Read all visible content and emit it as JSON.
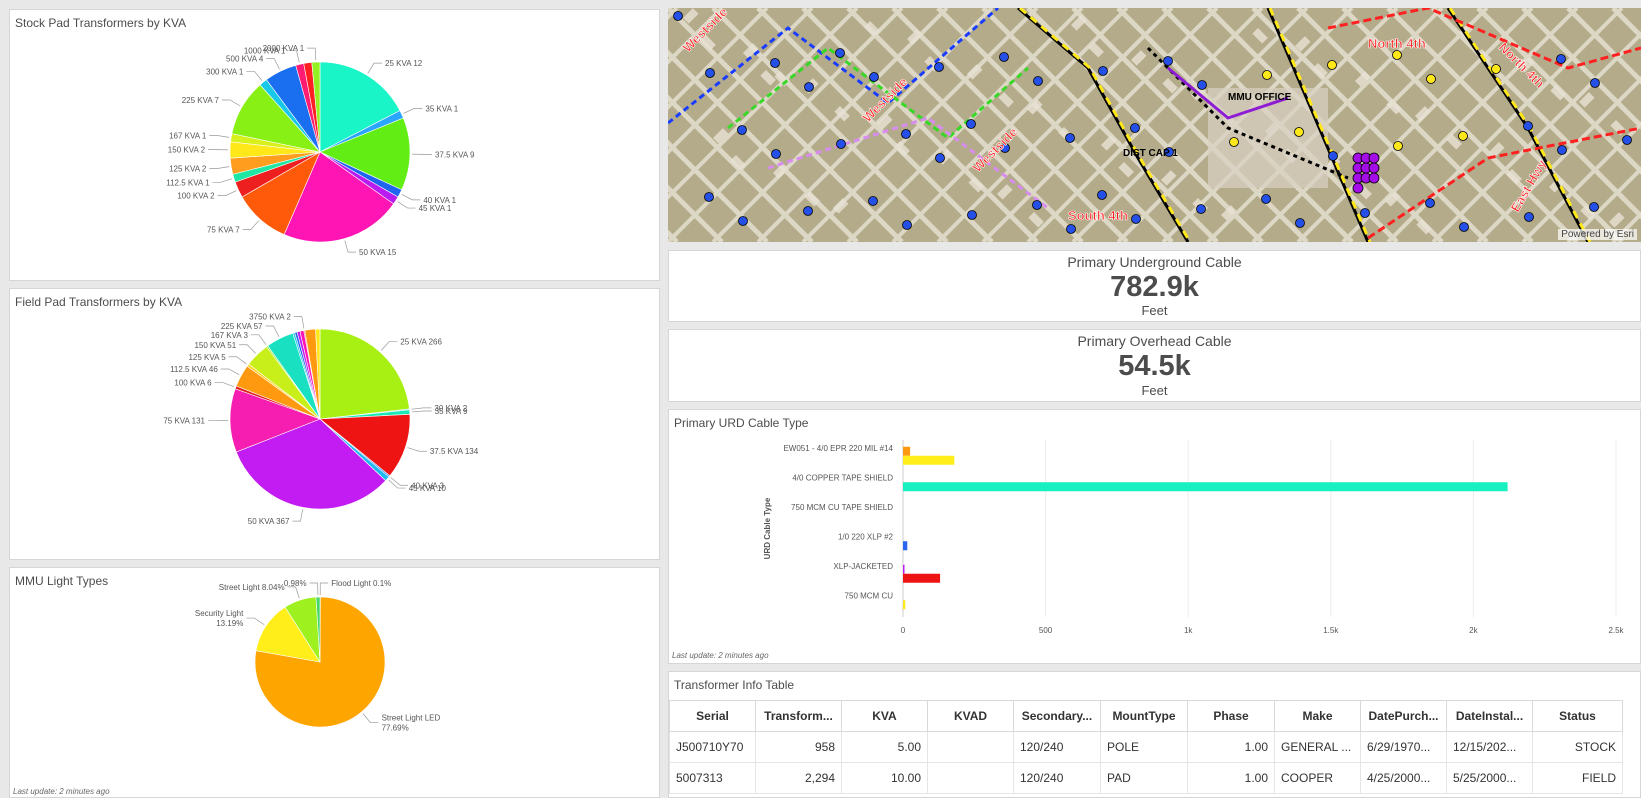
{
  "stock_pie": {
    "title": "Stock Pad Transformers by KVA",
    "chart_data": {
      "type": "pie",
      "title": "Stock Pad Transformers by KVA",
      "slices": [
        {
          "label": "25 KVA 12",
          "value": 12,
          "color": "#19f5c7"
        },
        {
          "label": "35 KVA 1",
          "value": 1,
          "color": "#2aa6ff"
        },
        {
          "label": "37.5 KVA 9",
          "value": 9,
          "color": "#62ee15"
        },
        {
          "label": "40 KVA 1",
          "value": 1,
          "color": "#1f65f0"
        },
        {
          "label": "45 KVA 1",
          "value": 1,
          "color": "#b91cf0"
        },
        {
          "label": "50 KVA 15",
          "value": 15,
          "color": "#ff14b4"
        },
        {
          "label": "75 KVA 7",
          "value": 7,
          "color": "#ff5a0a"
        },
        {
          "label": "100 KVA 2",
          "value": 2,
          "color": "#ee1f1f"
        },
        {
          "label": "112.5 KVA 1",
          "value": 1,
          "color": "#20e6a4"
        },
        {
          "label": "125 KVA 2",
          "value": 2,
          "color": "#ff9d1e"
        },
        {
          "label": "150 KVA 2",
          "value": 2,
          "color": "#ffe81a"
        },
        {
          "label": "167 KVA 1",
          "value": 1,
          "color": "#d8f01c"
        },
        {
          "label": "225 KVA 7",
          "value": 7,
          "color": "#88f014"
        },
        {
          "label": "300 KVA 1",
          "value": 1,
          "color": "#18c8e8"
        },
        {
          "label": "500 KVA 4",
          "value": 4,
          "color": "#1a6ff0"
        },
        {
          "label": "1000 KVA 1",
          "value": 1,
          "color": "#ff1a72"
        },
        {
          "label": "",
          "value": 1,
          "color": "#ff2121"
        },
        {
          "label": "2000 KVA 1",
          "value": 1,
          "color": "#92f023"
        }
      ]
    }
  },
  "field_pie": {
    "title": "Field Pad Transformers by KVA",
    "chart_data": {
      "type": "pie",
      "title": "Field Pad Transformers by KVA",
      "slices": [
        {
          "label": "25 KVA 266",
          "value": 266,
          "color": "#a8f014"
        },
        {
          "label": "30 KVA 2",
          "value": 2,
          "color": "#1ec8e8"
        },
        {
          "label": "35 KVA 9",
          "value": 9,
          "color": "#18e8b4"
        },
        {
          "label": "37.5 KVA 134",
          "value": 134,
          "color": "#ee1414"
        },
        {
          "label": "40 KVA 3",
          "value": 3,
          "color": "#2a7af0"
        },
        {
          "label": "45 KVA 10",
          "value": 10,
          "color": "#1fb8f0"
        },
        {
          "label": "50 KVA 367",
          "value": 367,
          "color": "#c21cf2"
        },
        {
          "label": "75 KVA 131",
          "value": 131,
          "color": "#f51eb0"
        },
        {
          "label": "100 KVA 6",
          "value": 6,
          "color": "#e01e1e"
        },
        {
          "label": "112.5 KVA 46",
          "value": 46,
          "color": "#ff9a10"
        },
        {
          "label": "125 KVA 5",
          "value": 5,
          "color": "#ffcf1a"
        },
        {
          "label": "150 KVA 51",
          "value": 51,
          "color": "#c8ef1a"
        },
        {
          "label": "167 KVA 3",
          "value": 3,
          "color": "#7ee81c"
        },
        {
          "label": "225 KVA 57",
          "value": 57,
          "color": "#18e0c0"
        },
        {
          "label": "",
          "value": 4,
          "color": "#1ec8f0"
        },
        {
          "label": "",
          "value": 5,
          "color": "#2a66f0"
        },
        {
          "label": "",
          "value": 6,
          "color": "#c21cf2"
        },
        {
          "label": "",
          "value": 8,
          "color": "#ff14b4"
        },
        {
          "label": "3750 KVA 2",
          "value": 2,
          "color": "#ee1414"
        },
        {
          "label": "",
          "value": 22,
          "color": "#ff9a10"
        },
        {
          "label": "",
          "value": 9,
          "color": "#ffe81a"
        }
      ]
    }
  },
  "light_pie": {
    "title": "MMU Light Types",
    "last_update": "Last update: 2 minutes ago",
    "chart_data": {
      "type": "pie",
      "title": "MMU Light Types",
      "slices": [
        {
          "label": "Street Light LED",
          "pct": "77.69%",
          "value": 77.69,
          "color": "#ffa500"
        },
        {
          "label": "Security Light",
          "pct": "13.19%",
          "value": 13.19,
          "color": "#ffee1a"
        },
        {
          "label": "Street Light",
          "pct": "8.04%",
          "value": 8.04,
          "color": "#9ef01e"
        },
        {
          "label": "",
          "pct": "0.98%",
          "value": 0.98,
          "color": "#45d66a"
        },
        {
          "label": "Flood Light",
          "pct": "0.1%",
          "value": 0.1,
          "color": "#ff3a3a"
        }
      ]
    }
  },
  "map": {
    "credit": "Powered by Esri",
    "labels": [
      "Westside",
      "North 4th",
      "South 4th",
      "MMU OFFICE",
      "DIST CAP 1",
      "East Hwy"
    ]
  },
  "underground": {
    "title": "Primary Underground Cable",
    "value": "782.9k",
    "unit": "Feet"
  },
  "overhead": {
    "title": "Primary Overhead Cable",
    "value": "54.5k",
    "unit": "Feet"
  },
  "urd_chart": {
    "title": "Primary URD Cable Type",
    "last_update": "Last update: 2 minutes ago",
    "chart_data": {
      "type": "bar",
      "orientation": "horizontal",
      "ylabel": "URD Cable Type",
      "xlim": [
        0,
        2500
      ],
      "xticks": [
        0,
        500,
        1000,
        1500,
        2000,
        2500
      ],
      "xtick_labels": [
        "0",
        "500",
        "1k",
        "1.5k",
        "2k",
        "2.5k"
      ],
      "categories": [
        "EW051 - 4/0 EPR 220 MIL #14",
        "4/0 COPPER TAPE SHIELD",
        "750 MCM CU TAPE SHIELD",
        "1/0 220 XLP #2",
        "XLP-JACKETED",
        "750 MCM CU"
      ],
      "bars": [
        [
          {
            "value": 25,
            "color": "#ff9a10"
          },
          {
            "value": 180,
            "color": "#ffee1a"
          }
        ],
        [
          {
            "value": 2120,
            "color": "#19f0c0"
          }
        ],
        [],
        [
          {
            "value": 15,
            "color": "#2a66f0"
          }
        ],
        [
          {
            "value": 5,
            "color": "#c21cf2"
          },
          {
            "value": 130,
            "color": "#ee1414"
          }
        ],
        [
          {
            "value": 8,
            "color": "#ffe81a"
          }
        ]
      ]
    }
  },
  "table": {
    "title": "Transformer Info Table",
    "columns": [
      "Serial",
      "Transform...",
      "KVA",
      "KVAD",
      "Secondary...",
      "MountType",
      "Phase",
      "Make",
      "DatePurch...",
      "DateInstal...",
      "Status"
    ],
    "rows": [
      [
        "J500710Y70",
        "958",
        "5.00",
        "",
        "120/240",
        "POLE",
        "1.00",
        "GENERAL ...",
        "6/29/1970...",
        "12/15/202...",
        "STOCK"
      ],
      [
        "5007313",
        "2,294",
        "10.00",
        "",
        "120/240",
        "PAD",
        "1.00",
        "COOPER",
        "4/25/2000...",
        "5/25/2000...",
        "FIELD"
      ]
    ]
  }
}
